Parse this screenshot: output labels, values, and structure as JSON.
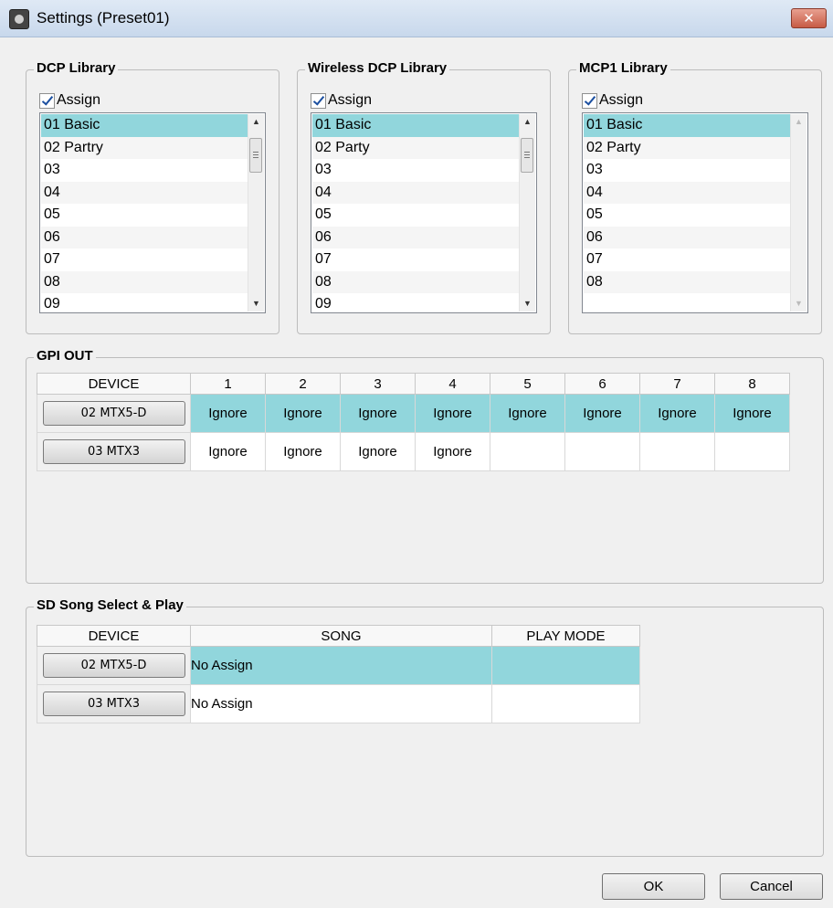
{
  "window": {
    "title": "Settings (Preset01)",
    "close_label": "✕"
  },
  "libraries": [
    {
      "legend": "DCP Library",
      "assign_label": "Assign",
      "assign_checked": true,
      "items": [
        "01 Basic",
        "02 Partry",
        "03",
        "04",
        "05",
        "06",
        "07",
        "08",
        "09"
      ],
      "selected_index": 0
    },
    {
      "legend": "Wireless DCP Library",
      "assign_label": "Assign",
      "assign_checked": true,
      "items": [
        "01 Basic",
        "02 Party",
        "03",
        "04",
        "05",
        "06",
        "07",
        "08",
        "09"
      ],
      "selected_index": 0
    },
    {
      "legend": "MCP1 Library",
      "assign_label": "Assign",
      "assign_checked": true,
      "items": [
        "01 Basic",
        "02 Party",
        "03",
        "04",
        "05",
        "06",
        "07",
        "08"
      ],
      "selected_index": 0
    }
  ],
  "gpi_out": {
    "legend": "GPI OUT",
    "headers": [
      "DEVICE",
      "1",
      "2",
      "3",
      "4",
      "5",
      "6",
      "7",
      "8"
    ],
    "rows": [
      {
        "device": "02 MTX5-D",
        "values": [
          "Ignore",
          "Ignore",
          "Ignore",
          "Ignore",
          "Ignore",
          "Ignore",
          "Ignore",
          "Ignore"
        ]
      },
      {
        "device": "03 MTX3",
        "values": [
          "Ignore",
          "Ignore",
          "Ignore",
          "Ignore",
          "",
          "",
          "",
          ""
        ]
      }
    ]
  },
  "sd_song": {
    "legend": "SD Song Select & Play",
    "headers": [
      "DEVICE",
      "SONG",
      "PLAY MODE"
    ],
    "rows": [
      {
        "device": "02 MTX5-D",
        "song": "No Assign",
        "play_mode": ""
      },
      {
        "device": "03 MTX3",
        "song": "No Assign",
        "play_mode": ""
      }
    ]
  },
  "footer": {
    "ok_label": "OK",
    "cancel_label": "Cancel"
  }
}
